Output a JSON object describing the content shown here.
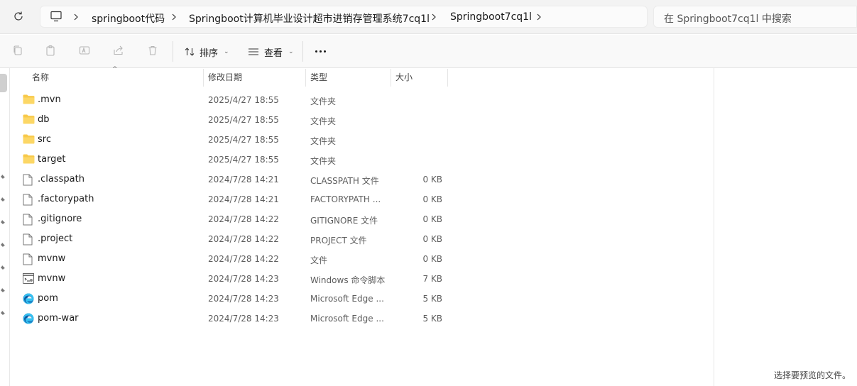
{
  "address_bar": {
    "breadcrumbs": [
      "springboot代码",
      "Springboot计算机毕业设计超市进销存管理系统7cq1l",
      "Springboot7cq1l"
    ],
    "search_placeholder": "在 Springboot7cq1l 中搜索"
  },
  "toolbar": {
    "sort_label": "排序",
    "view_label": "查看"
  },
  "columns": {
    "name": "名称",
    "date": "修改日期",
    "type": "类型",
    "size": "大小"
  },
  "files": [
    {
      "name": ".mvn",
      "date": "2025/4/27 18:55",
      "type": "文件夹",
      "size": "",
      "icon": "folder-icon"
    },
    {
      "name": "db",
      "date": "2025/4/27 18:55",
      "type": "文件夹",
      "size": "",
      "icon": "folder-icon"
    },
    {
      "name": "src",
      "date": "2025/4/27 18:55",
      "type": "文件夹",
      "size": "",
      "icon": "folder-icon"
    },
    {
      "name": "target",
      "date": "2025/4/27 18:55",
      "type": "文件夹",
      "size": "",
      "icon": "folder-icon"
    },
    {
      "name": ".classpath",
      "date": "2024/7/28 14:21",
      "type": "CLASSPATH 文件",
      "size": "0 KB",
      "icon": "file-icon"
    },
    {
      "name": ".factorypath",
      "date": "2024/7/28 14:21",
      "type": "FACTORYPATH ...",
      "size": "0 KB",
      "icon": "file-icon"
    },
    {
      "name": ".gitignore",
      "date": "2024/7/28 14:22",
      "type": "GITIGNORE 文件",
      "size": "0 KB",
      "icon": "file-icon"
    },
    {
      "name": ".project",
      "date": "2024/7/28 14:22",
      "type": "PROJECT 文件",
      "size": "0 KB",
      "icon": "file-icon"
    },
    {
      "name": "mvnw",
      "date": "2024/7/28 14:22",
      "type": "文件",
      "size": "0 KB",
      "icon": "file-icon"
    },
    {
      "name": "mvnw",
      "date": "2024/7/28 14:23",
      "type": "Windows 命令脚本",
      "size": "7 KB",
      "icon": "script-icon"
    },
    {
      "name": "pom",
      "date": "2024/7/28 14:23",
      "type": "Microsoft Edge ...",
      "size": "5 KB",
      "icon": "edge-icon"
    },
    {
      "name": "pom-war",
      "date": "2024/7/28 14:23",
      "type": "Microsoft Edge ...",
      "size": "5 KB",
      "icon": "edge-icon"
    }
  ],
  "preview": {
    "empty_text": "选择要预览的文件。"
  }
}
